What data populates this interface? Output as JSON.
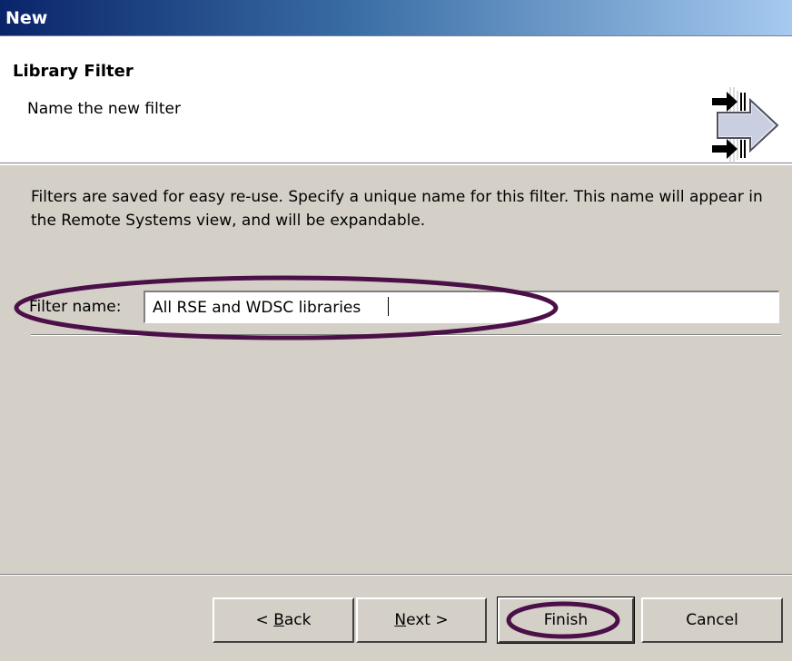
{
  "window": {
    "title": "New"
  },
  "header": {
    "title": "Library Filter",
    "description": "Name the new filter",
    "icon": "new-filter-wizard-icon"
  },
  "body": {
    "description": "Filters are saved for easy re-use. Specify a unique name for this filter. This name will appear in the Remote Systems view, and will be expandable."
  },
  "filter": {
    "label": "Filter name:",
    "value": "All RSE and WDSC libraries"
  },
  "buttons": {
    "back": {
      "before": "< ",
      "mnemonic": "B",
      "after": "ack"
    },
    "next": {
      "mnemonic": "N",
      "after": "ext >"
    },
    "finish": {
      "label": "Finish"
    },
    "cancel": {
      "label": "Cancel"
    }
  },
  "annotation_color": "#4b1048"
}
